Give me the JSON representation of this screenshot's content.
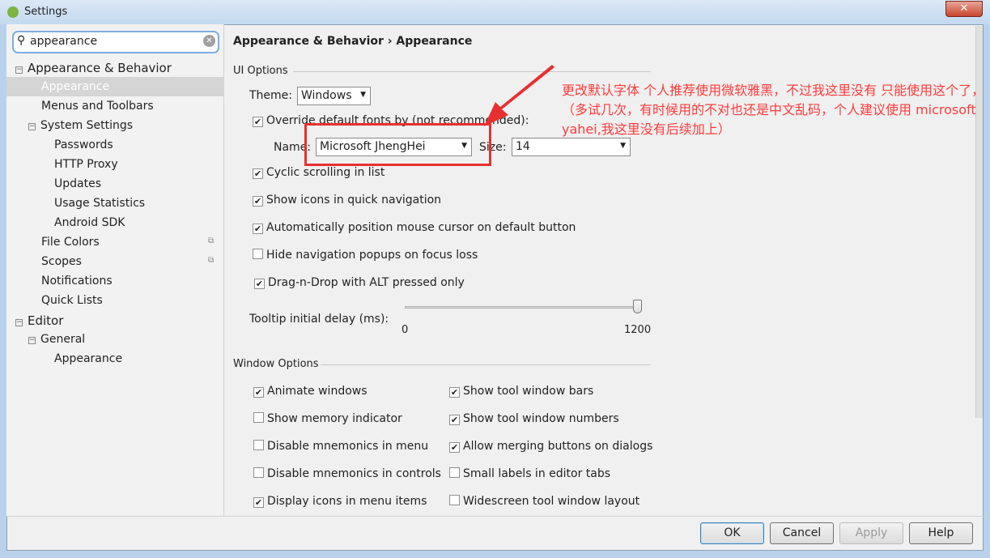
{
  "window": {
    "title": "Settings",
    "close": "✕"
  },
  "search": {
    "value": "appearance"
  },
  "tree": [
    {
      "label": "Appearance & Behavior",
      "level": 0,
      "expand": "−"
    },
    {
      "label": "Appearance",
      "level": 1,
      "selected": true
    },
    {
      "label": "Menus and Toolbars",
      "level": 1
    },
    {
      "label": "System Settings",
      "level": 1,
      "expand": "−"
    },
    {
      "label": "Passwords",
      "level": 2
    },
    {
      "label": "HTTP Proxy",
      "level": 2
    },
    {
      "label": "Updates",
      "level": 2
    },
    {
      "label": "Usage Statistics",
      "level": 2
    },
    {
      "label": "Android SDK",
      "level": 2
    },
    {
      "label": "File Colors",
      "level": 1,
      "copy": true
    },
    {
      "label": "Scopes",
      "level": 1,
      "copy": true
    },
    {
      "label": "Notifications",
      "level": 1
    },
    {
      "label": "Quick Lists",
      "level": 1
    },
    {
      "label": "Editor",
      "level": 0,
      "expand": "−"
    },
    {
      "label": "General",
      "level": 1,
      "expand": "−"
    },
    {
      "label": "Appearance",
      "level": 2
    }
  ],
  "breadcrumb": "Appearance & Behavior › Appearance",
  "ui_options": {
    "title": "UI Options",
    "theme_label": "Theme:",
    "theme": "Windows",
    "override": {
      "label": "Override default fonts by (not recommended):",
      "checked": true
    },
    "name_label": "Name:",
    "name": "Microsoft JhengHei",
    "size_label": "Size:",
    "size": "14",
    "checks": [
      {
        "label": "Cyclic scrolling in list",
        "checked": true
      },
      {
        "label": "Show icons in quick navigation",
        "checked": true
      },
      {
        "label": "Automatically position mouse cursor on default button",
        "checked": true
      },
      {
        "label": "Hide navigation popups on focus loss",
        "checked": false
      },
      {
        "label": "Drag-n-Drop with ALT pressed only",
        "checked": true
      }
    ],
    "tooltip_label": "Tooltip initial delay (ms):",
    "tooltip_min": "0",
    "tooltip_max": "1200",
    "tooltip_value": 1200
  },
  "window_options": {
    "title": "Window Options",
    "left": [
      {
        "label": "Animate windows",
        "checked": true
      },
      {
        "label": "Show memory indicator",
        "checked": false
      },
      {
        "label": "Disable mnemonics in menu",
        "checked": false
      },
      {
        "label": "Disable mnemonics in controls",
        "checked": false
      },
      {
        "label": "Display icons in menu items",
        "checked": true
      }
    ],
    "right": [
      {
        "label": "Show tool window bars",
        "checked": true
      },
      {
        "label": "Show tool window numbers",
        "checked": true
      },
      {
        "label": "Allow merging buttons on dialogs",
        "checked": true
      },
      {
        "label": "Small labels in editor tabs",
        "checked": false
      },
      {
        "label": "Widescreen tool window layout",
        "checked": false
      }
    ]
  },
  "annotation": "更改默认字体 个人推荐使用微软雅黑，不过我这里没有 只能使用这个了，（多试几次，有时候用的不对也还是中文乱码，个人建议使用 microsoft yahei,我这里没有后续加上）",
  "annotation_color": "#ff3b3b",
  "buttons": {
    "ok": "OK",
    "cancel": "Cancel",
    "apply": "Apply",
    "help": "Help"
  }
}
